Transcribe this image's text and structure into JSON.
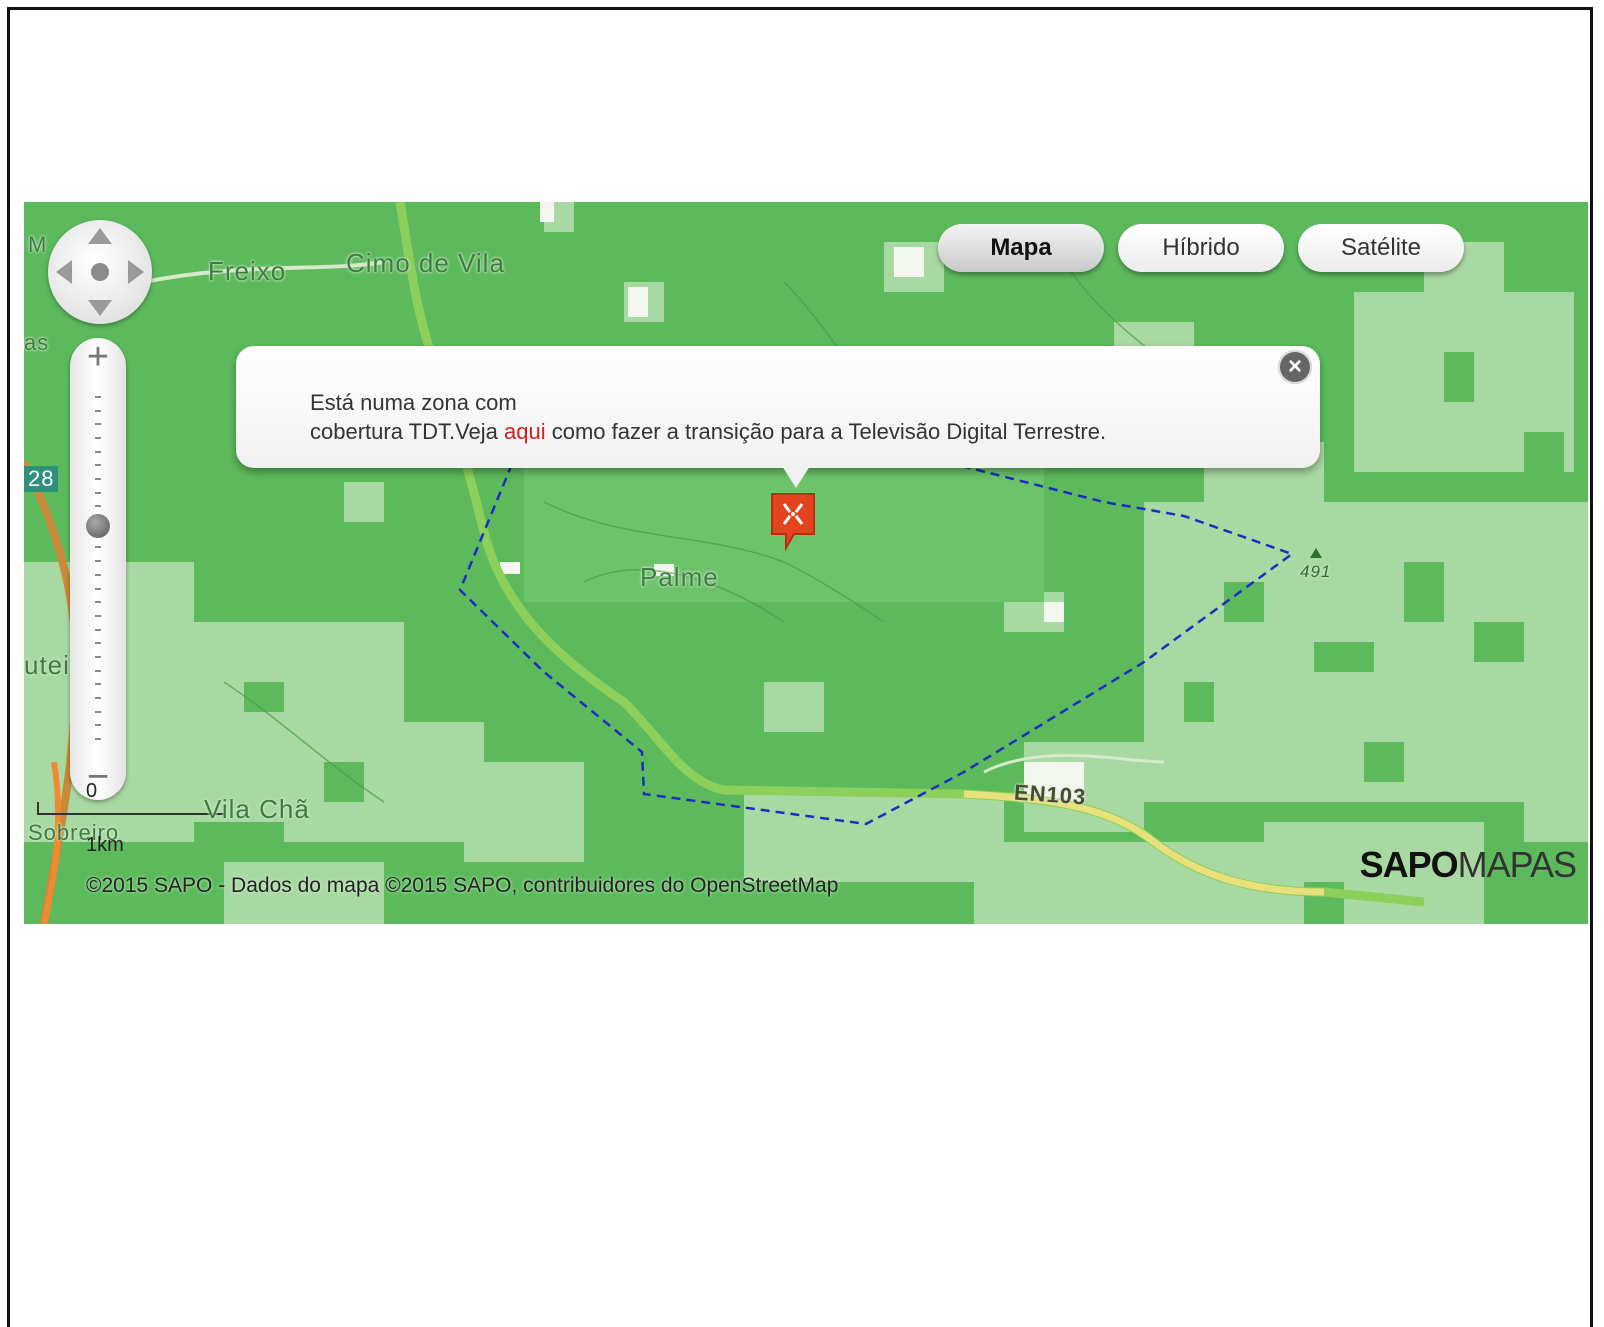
{
  "map": {
    "type_buttons": [
      {
        "label": "Mapa",
        "active": true
      },
      {
        "label": "Híbrido",
        "active": false
      },
      {
        "label": "Satélite",
        "active": false
      }
    ],
    "place_labels": [
      "Freixo",
      "Cimo de Vila",
      "Palme",
      "Vila Chã",
      "Sobreiro"
    ],
    "clipped_labels": [
      "M",
      "as",
      "uteir"
    ],
    "road_labels": [
      "EN103",
      "28"
    ],
    "elevation_label": "491",
    "zoom": {
      "level_fraction": 0.38
    }
  },
  "popup": {
    "line1": "Está numa zona com",
    "line2_before": "cobertura TDT.Veja ",
    "link": "aqui",
    "line2_after": " como fazer a transição para a Televisão Digital Terrestre."
  },
  "scale": {
    "zero": "0",
    "unit": "1km"
  },
  "attribution": "©2015 SAPO - Dados do mapa ©2015 SAPO, contribuidores do OpenStreetMap",
  "brand": {
    "part1": "SAPO",
    "part2": "MAPAS"
  },
  "colors": {
    "forest": "#5cba5c",
    "light_green": "#a8d8a0",
    "coverage_boundary": "#1a2fbf",
    "marker": "#e3441d",
    "road": "#e8e07a"
  }
}
